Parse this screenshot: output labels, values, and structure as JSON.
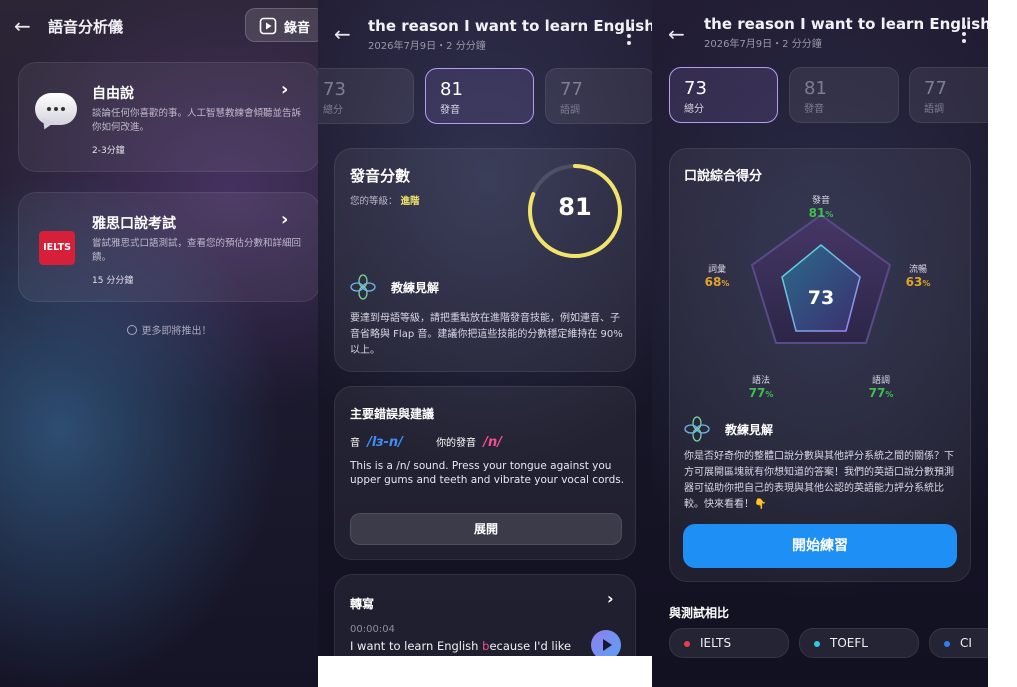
{
  "panel1": {
    "title": "語音分析儀",
    "record_label": "錄音",
    "free_talk": {
      "title": "自由說",
      "desc": "談論任何你喜歡的事。人工智慧教練會傾聽並告訴你如何改進。",
      "duration": "2-3分鐘"
    },
    "ielts": {
      "logo": "IELTS",
      "title": "雅思口說考試",
      "desc": "嘗試雅思式口語測試，查看您的預估分數和詳細回饋。",
      "duration": "15 分分鐘"
    },
    "more": "更多即將推出！"
  },
  "session": {
    "title": "the reason I want to learn English",
    "subtitle": "2026年7月9日・2 分分鐘"
  },
  "panel2": {
    "tabs": [
      {
        "num": "73",
        "label": "總分"
      },
      {
        "num": "81",
        "label": "發音"
      },
      {
        "num": "77",
        "label": "語調"
      }
    ],
    "score_card": {
      "title": "發音分數",
      "level_label": "您的等級：",
      "level_value": "進階",
      "score": "81",
      "score_value": 81,
      "coach_title": "教練見解",
      "coach_text": "要達到母語等級，請把重點放在進階發音技能，例如連音、子音省略與 Flap 音。建議你把這些技能的分數穩定維持在 90% 以上。"
    },
    "mistakes": {
      "title": "主要錯誤與建議",
      "sound_label": "音",
      "sound_ipa": "/lɜ-n/",
      "your_label": "你的發音",
      "your_ipa": "/n/",
      "text": "This is a /n/ sound. Press your tongue against you upper gums and teeth and vibrate your vocal cords.",
      "expand": "展開"
    },
    "transcript": {
      "title": "轉寫",
      "time": "00:00:04",
      "text_before": "I want to learn English ",
      "text_highlight": "b",
      "text_after": "ecause I'd like"
    }
  },
  "panel3": {
    "tabs": [
      {
        "num": "73",
        "label": "總分"
      },
      {
        "num": "81",
        "label": "發音"
      },
      {
        "num": "77",
        "label": "語調"
      }
    ],
    "radar": {
      "title": "口說綜合得分",
      "center": "73",
      "labels": [
        {
          "name": "發音",
          "value": "81",
          "pct": "%",
          "color": "#3fbf4f"
        },
        {
          "name": "流暢",
          "value": "63",
          "pct": "%",
          "color": "#e0a526"
        },
        {
          "name": "語調",
          "value": "77",
          "pct": "%",
          "color": "#3fbf4f"
        },
        {
          "name": "語法",
          "value": "77",
          "pct": "%",
          "color": "#3fbf4f"
        },
        {
          "name": "詞彙",
          "value": "68",
          "pct": "%",
          "color": "#e0a526"
        }
      ]
    },
    "coach_title": "教練見解",
    "coach_text": "你是否好奇你的整體口說分數與其他評分系統之間的關係？下方可展開區塊就有你想知道的答案！我們的英語口說分數預測器可協助你把自己的表現與其他公認的英語能力評分系統比較。快來看看！👇",
    "start_button": "開始練習",
    "compare_title": "與測試相比",
    "compare": [
      {
        "name": "IELTS",
        "color": "#e2404f"
      },
      {
        "name": "TOEFL",
        "color": "#35c7e8"
      },
      {
        "name": "CI",
        "color": "#2f7ff0"
      }
    ]
  },
  "colors": {
    "accent_blue": "#1e8ff5",
    "purple_border": "#b69cf0",
    "score_ring": "#f2e46a",
    "level_yellow": "#f2e46a",
    "ipa_blue": "#3d8ff5",
    "ipa_pink": "#f04f8d"
  }
}
